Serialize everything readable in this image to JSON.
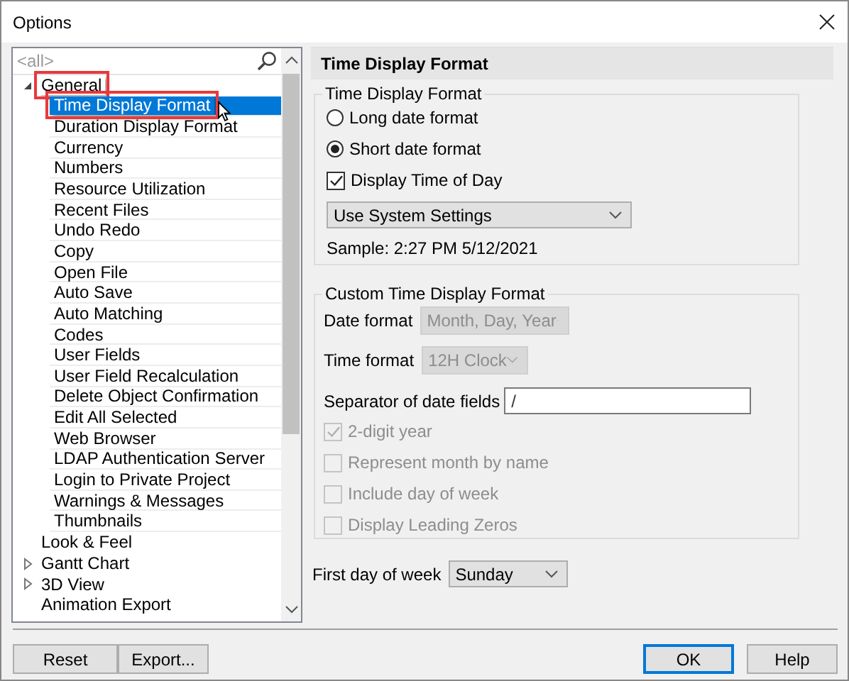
{
  "window": {
    "title": "Options"
  },
  "tree": {
    "search": {
      "placeholder": "<all>"
    },
    "items": [
      {
        "label": "General",
        "expanded": true,
        "annotated": true,
        "selected": false,
        "children": [
          {
            "label": "Time Display Format",
            "selected": true,
            "annotated": true
          },
          {
            "label": "Duration Display Format",
            "selected": false,
            "annotated": false
          },
          {
            "label": "Currency",
            "selected": false,
            "annotated": false
          },
          {
            "label": "Numbers",
            "selected": false,
            "annotated": false
          },
          {
            "label": "Resource Utilization",
            "selected": false,
            "annotated": false
          },
          {
            "label": "Recent Files",
            "selected": false,
            "annotated": false
          },
          {
            "label": "Undo Redo",
            "selected": false,
            "annotated": false
          },
          {
            "label": "Copy",
            "selected": false,
            "annotated": false
          },
          {
            "label": "Open File",
            "selected": false,
            "annotated": false
          },
          {
            "label": "Auto Save",
            "selected": false,
            "annotated": false
          },
          {
            "label": "Auto Matching",
            "selected": false,
            "annotated": false
          },
          {
            "label": "Codes",
            "selected": false,
            "annotated": false
          },
          {
            "label": "User Fields",
            "selected": false,
            "annotated": false
          },
          {
            "label": "User Field Recalculation",
            "selected": false,
            "annotated": false
          },
          {
            "label": "Delete Object Confirmation",
            "selected": false,
            "annotated": false
          },
          {
            "label": "Edit All Selected",
            "selected": false,
            "annotated": false
          },
          {
            "label": "Web Browser",
            "selected": false,
            "annotated": false
          },
          {
            "label": "LDAP Authentication Server",
            "selected": false,
            "annotated": false
          },
          {
            "label": "Login to Private Project",
            "selected": false,
            "annotated": false
          },
          {
            "label": "Warnings & Messages",
            "selected": false,
            "annotated": false
          },
          {
            "label": "Thumbnails",
            "selected": false,
            "annotated": false
          }
        ]
      },
      {
        "label": "Look & Feel",
        "selected": false,
        "annotated": false
      },
      {
        "label": "Gantt Chart",
        "expanded": false,
        "selected": false,
        "annotated": false
      },
      {
        "label": "3D View",
        "expanded": false,
        "selected": false,
        "annotated": false
      },
      {
        "label": "Animation Export",
        "selected": false,
        "annotated": false
      }
    ]
  },
  "panel": {
    "title": "Time Display Format",
    "display_group": {
      "title": "Time Display Format",
      "radios": [
        {
          "label": "Long date format",
          "selected": false
        },
        {
          "label": "Short date format",
          "selected": true
        }
      ],
      "checkbox": {
        "label": "Display Time of Day",
        "checked": true
      },
      "dropdown": {
        "value": "Use System Settings"
      },
      "sample": "Sample: 2:27 PM 5/12/2021"
    },
    "custom_group": {
      "title": "Custom Time Display Format",
      "date_format": {
        "label": "Date format",
        "value": "Month, Day, Year",
        "disabled": true
      },
      "time_format": {
        "label": "Time format",
        "value": "12H Clock",
        "disabled": true
      },
      "separator": {
        "label": "Separator of date fields",
        "value": "/"
      },
      "checkboxes": [
        {
          "label": "2-digit year",
          "checked": true,
          "disabled": true
        },
        {
          "label": "Represent month by name",
          "checked": false,
          "disabled": true
        },
        {
          "label": "Include day of week",
          "checked": false,
          "disabled": true
        },
        {
          "label": "Display Leading Zeros",
          "checked": false,
          "disabled": true
        }
      ]
    },
    "first_day": {
      "label": "First day of week",
      "value": "Sunday",
      "disabled": false
    }
  },
  "buttons": [
    {
      "label": "Reset",
      "default": false
    },
    {
      "label": "Export...",
      "default": false
    },
    {
      "label": "OK",
      "default": true
    },
    {
      "label": "Help",
      "default": false
    }
  ]
}
